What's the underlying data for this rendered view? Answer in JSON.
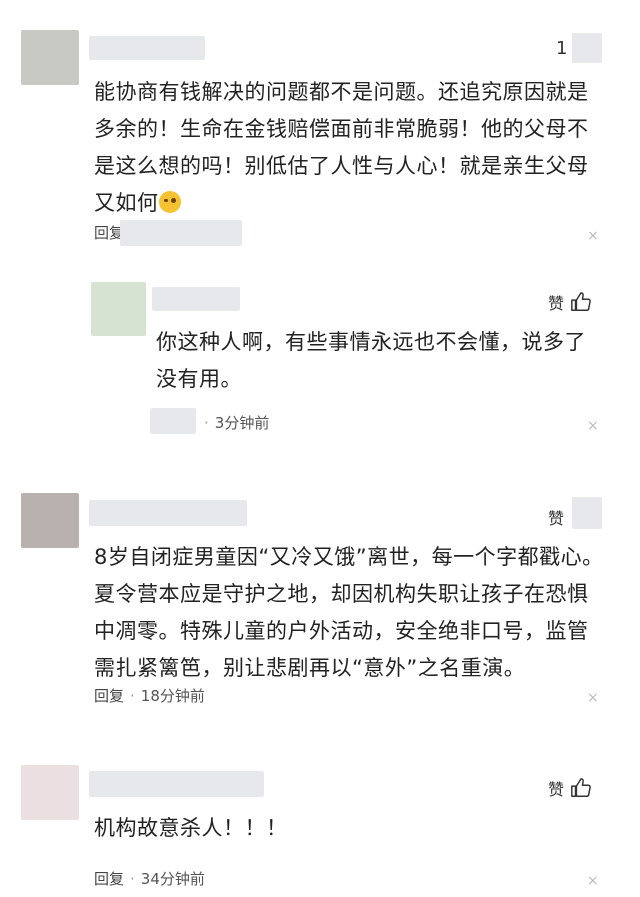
{
  "comments": [
    {
      "like_count": "1",
      "text_lines": [
        "能协商有钱解决的问题都不是问题。还追究原因就是",
        "多余的！生命在金钱赔偿面前非常脆弱！他的父母不",
        "是这么想的吗！别低估了人性与人心！就是亲生父母",
        "又如何"
      ],
      "reply_label": "回复",
      "close": "×",
      "reply": {
        "like_label": "赞",
        "text_lines": [
          "你这种人啊，有些事情永远也不会懂，说多了",
          "没有用。"
        ],
        "time": "3分钟前",
        "close": "×"
      }
    },
    {
      "like_label": "赞",
      "text_lines": [
        "8岁自闭症男童因“又冷又饿”离世，每一个字都戳心。",
        "夏令营本应是守护之地，却因机构失职让孩子在恐惧",
        "中凋零。特殊儿童的户外活动，安全绝非口号，监管",
        "需扎紧篱笆，别让悲剧再以“意外”之名重演。"
      ],
      "reply_label": "回复",
      "time": "18分钟前",
      "close": "×"
    },
    {
      "like_label": "赞",
      "text_lines": [
        "机构故意杀人！！！"
      ],
      "reply_label": "回复",
      "time": "34分钟前",
      "close": "×"
    }
  ],
  "colors": {
    "avatar1": "#c9c9c3",
    "avatar_reply": "#d6e3d3",
    "avatar2": "#b9b1ae",
    "avatar3": "#ecdfe2"
  },
  "icons": [
    "smirk-emoji-icon",
    "thumbs-up-icon",
    "close-icon"
  ]
}
